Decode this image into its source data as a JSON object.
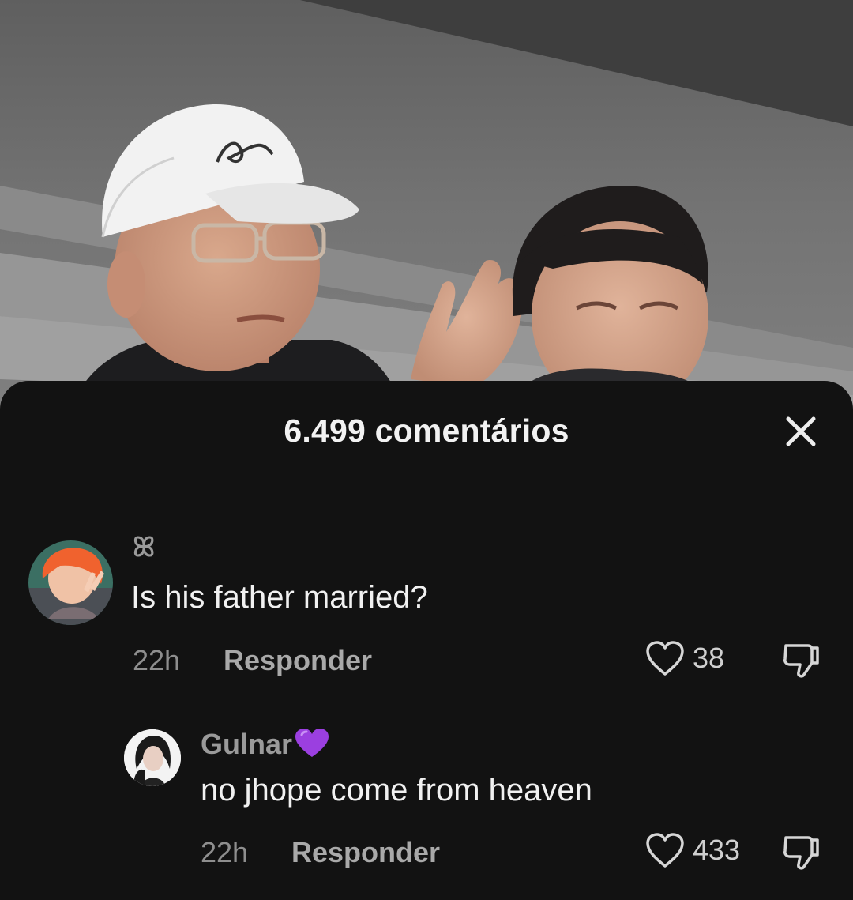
{
  "header": {
    "title": "6.499 comentários"
  },
  "comments": [
    {
      "username": "ꕤ",
      "text": "Is his father married?",
      "time": "22h",
      "reply_label": "Responder",
      "likes": "38"
    },
    {
      "username": "Gulnar",
      "username_emoji": "purple-heart-icon",
      "text": "no jhope come from heaven",
      "time": "22h",
      "reply_label": "Responder",
      "likes": "433"
    }
  ],
  "colors": {
    "sheet_background": "#121212",
    "primary_text": "#f1f1f1",
    "secondary_text": "#8e8e8e",
    "heart_emoji": "#9b3fe0"
  }
}
